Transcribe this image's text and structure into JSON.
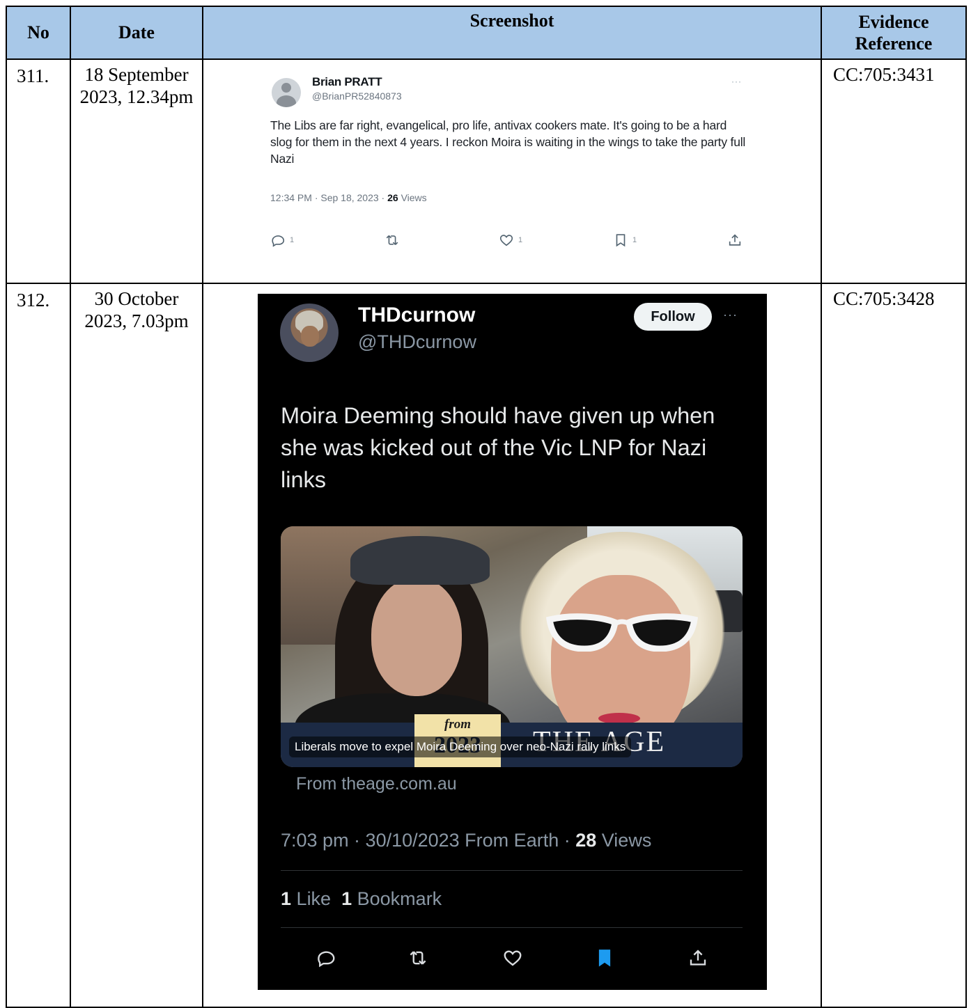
{
  "table": {
    "headers": {
      "no": "No",
      "date": "Date",
      "screenshot": "Screenshot",
      "reference": "Evidence Reference"
    },
    "rows": [
      {
        "no": "311.",
        "date": "18 September 2023, 12.34pm",
        "reference": "CC:705:3431",
        "tweet": {
          "name": "Brian PRATT",
          "handle": "@BrianPR52840873",
          "more": "···",
          "text": "The Libs are far right, evangelical, pro life, antivax cookers mate. It's going to be a hard slog for them in the next 4 years. I reckon Moira is waiting in the wings to take the party full Nazi",
          "timestamp": "12:34 PM · Sep 18, 2023 · ",
          "views_count": "26",
          "views_label": "Views",
          "reply_count": "1",
          "like_count": "1",
          "bookmark_count": "1",
          "icons": [
            "reply-icon",
            "retweet-icon",
            "like-icon",
            "bookmark-icon",
            "share-icon"
          ]
        }
      },
      {
        "no": "312.",
        "date": "30 October 2023, 7.03pm",
        "reference": "CC:705:3428",
        "tweet": {
          "name": "THDcurnow",
          "handle": "@THDcurnow",
          "follow_label": "Follow",
          "more": "···",
          "text": "Moira Deeming should have given up when she was kicked out of the Vic LNP for Nazi links",
          "card": {
            "from_label": "from",
            "year": "2023",
            "masthead": "THE AGE",
            "headline": "Liberals move to expel Moira Deeming over neo-Nazi rally links",
            "source": "From theage.com.au"
          },
          "timestamp": "7:03 pm · 30/10/2023 From Earth · ",
          "views_count": "28",
          "views_label": "Views",
          "like_count": "1",
          "like_label": "Like",
          "bookmark_count": "1",
          "bookmark_label": "Bookmark",
          "accent_color": "#1d9bf0",
          "icons": [
            "reply-icon",
            "retweet-icon",
            "like-icon",
            "bookmark-filled-icon",
            "share-icon"
          ]
        }
      }
    ]
  }
}
